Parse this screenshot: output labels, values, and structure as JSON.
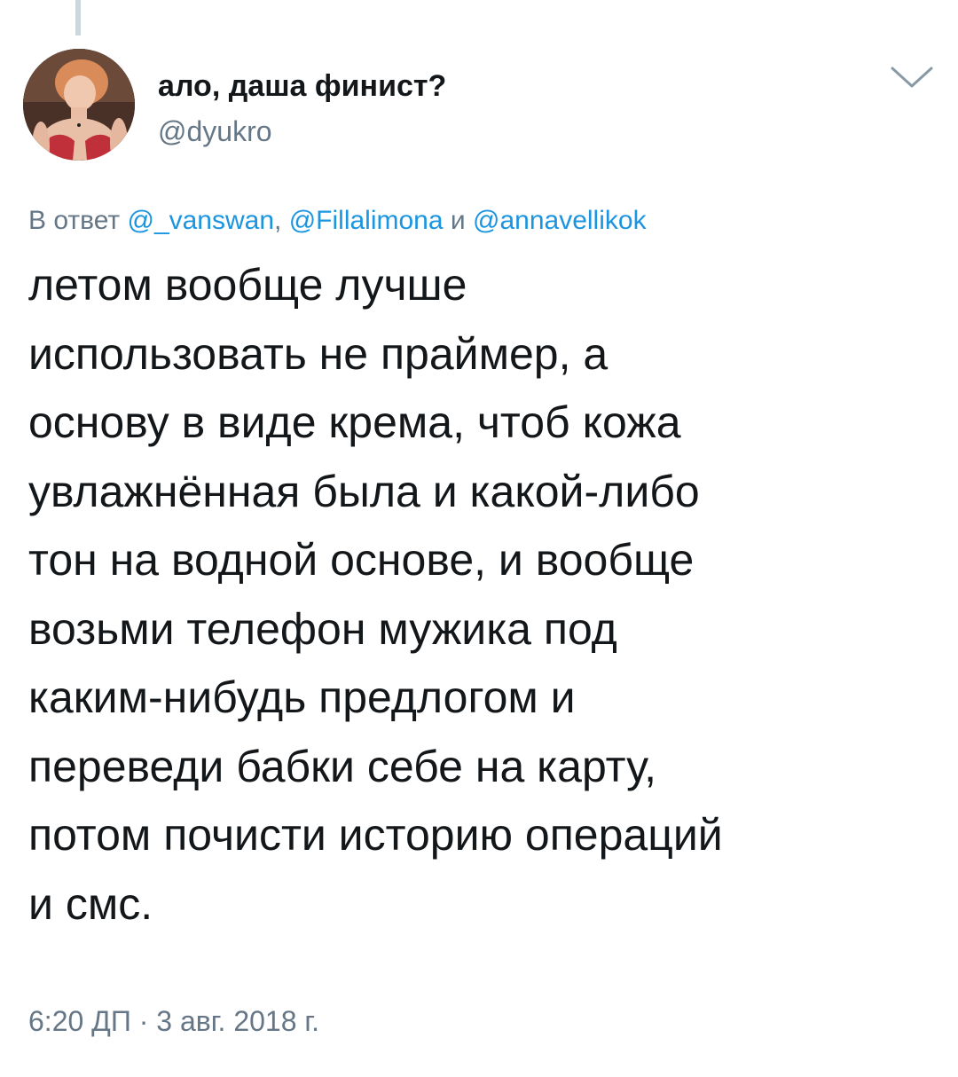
{
  "tweet": {
    "author": {
      "display_name": "ало, даша финист?",
      "handle": "@dyukro",
      "avatar_icon": "user-avatar-photo"
    },
    "menu_icon": "chevron-down-icon",
    "reply_to": {
      "prefix": "В ответ",
      "mentions": [
        "@_vanswan",
        "@Fillalimona",
        "@annavellikok"
      ],
      "separator": ",",
      "conjunction": "и"
    },
    "text_lines": [
      "летом вообще лучше",
      "использовать не праймер, а",
      "основу в виде крема, чтоб кожа",
      "увлажнённая была и какой-либо",
      "тон на водной основе, и вообще",
      "возьми телефон мужика под",
      "каким-нибудь предлогом и",
      "переведи бабки себе на карту,",
      "потом почисти историю операций",
      "и смс."
    ],
    "timestamp": "6:20 ДП · 3 авг. 2018 г."
  },
  "colors": {
    "text": "#14171a",
    "secondary": "#657786",
    "link": "#1b95e0",
    "thread_line": "#ccd6dd"
  }
}
